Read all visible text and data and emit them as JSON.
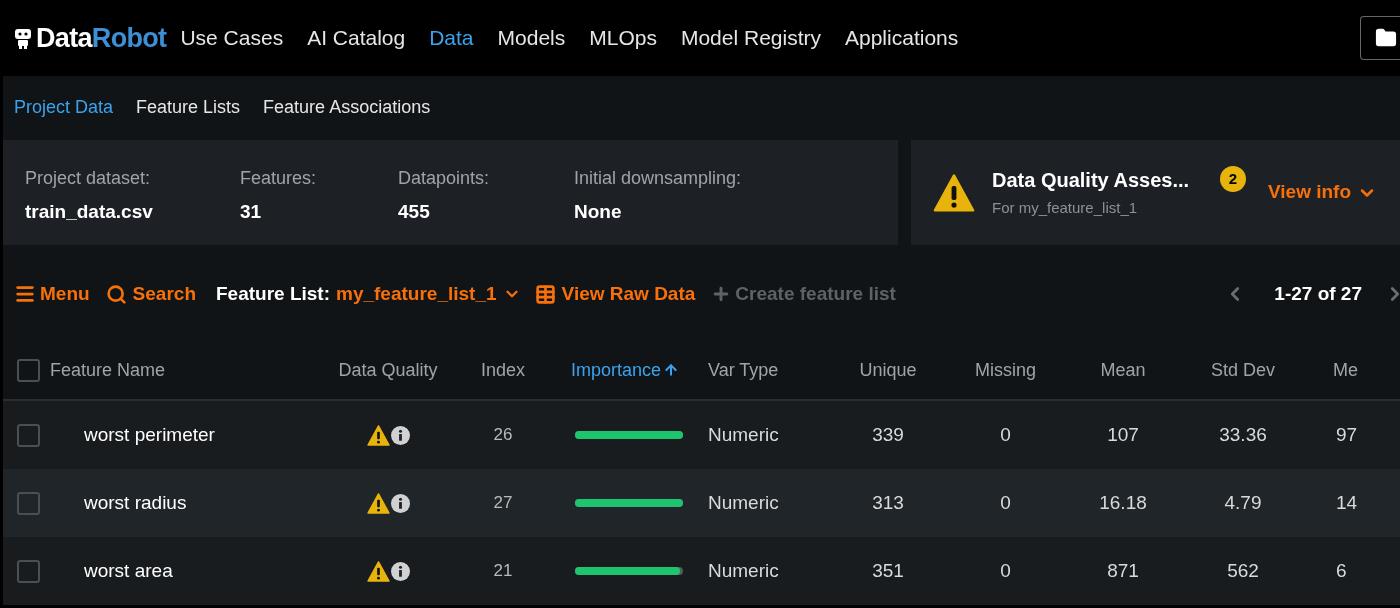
{
  "logo": {
    "part_1": "Data",
    "part_2": "Robot"
  },
  "nav": [
    {
      "label": "Use Cases",
      "selected": false
    },
    {
      "label": "AI Catalog",
      "selected": false
    },
    {
      "label": "Data",
      "selected": true
    },
    {
      "label": "Models",
      "selected": false
    },
    {
      "label": "MLOps",
      "selected": false
    },
    {
      "label": "Model Registry",
      "selected": false
    },
    {
      "label": "Applications",
      "selected": false
    }
  ],
  "subtabs": [
    {
      "label": "Project Data",
      "selected": true
    },
    {
      "label": "Feature Lists",
      "selected": false
    },
    {
      "label": "Feature Associations",
      "selected": false
    }
  ],
  "summary": [
    {
      "label": "Project dataset:",
      "value": "train_data.csv"
    },
    {
      "label": "Features:",
      "value": "31"
    },
    {
      "label": "Datapoints:",
      "value": "455"
    },
    {
      "label": "Initial downsampling:",
      "value": "None"
    }
  ],
  "quality": {
    "title": "Data Quality Asses...",
    "subtitle": "For my_feature_list_1",
    "count": "2",
    "action": "View info"
  },
  "toolbar": {
    "menu": "Menu",
    "search": "Search",
    "feature_list_label": "Feature List:",
    "feature_list_value": "my_feature_list_1",
    "raw_data": "View Raw Data",
    "create": "Create feature list",
    "create_disabled": true,
    "pagination": "1-27 of 27"
  },
  "table": {
    "select_all_checked": false,
    "columns": [
      {
        "label": "Feature Name",
        "sorted": false
      },
      {
        "label": "Data Quality",
        "sorted": false
      },
      {
        "label": "Index",
        "sorted": false
      },
      {
        "label": "Importance",
        "sorted": true
      },
      {
        "label": "Var Type",
        "sorted": false
      },
      {
        "label": "Unique",
        "sorted": false
      },
      {
        "label": "Missing",
        "sorted": false
      },
      {
        "label": "Mean",
        "sorted": false
      },
      {
        "label": "Std Dev",
        "sorted": false
      },
      {
        "label": "Me",
        "sorted": false
      }
    ],
    "rows": [
      {
        "checked": false,
        "name": "worst perimeter",
        "warning": true,
        "index": "26",
        "level": 1,
        "var_type": "Numeric",
        "unique": "339",
        "missing": "0",
        "mean": "107",
        "std_dev": "33.36",
        "column_10": "97"
      },
      {
        "checked": false,
        "name": "worst radius",
        "warning": true,
        "index": "27",
        "level": 1,
        "var_type": "Numeric",
        "unique": "313",
        "missing": "0",
        "mean": "16.18",
        "std_dev": "4.79",
        "column_10": "14"
      },
      {
        "checked": false,
        "name": "worst area",
        "warning": true,
        "index": "21",
        "level": 0.97,
        "var_type": "Numeric",
        "unique": "351",
        "missing": "0",
        "mean": "871",
        "std_dev": "562",
        "column_10": "6"
      }
    ]
  }
}
